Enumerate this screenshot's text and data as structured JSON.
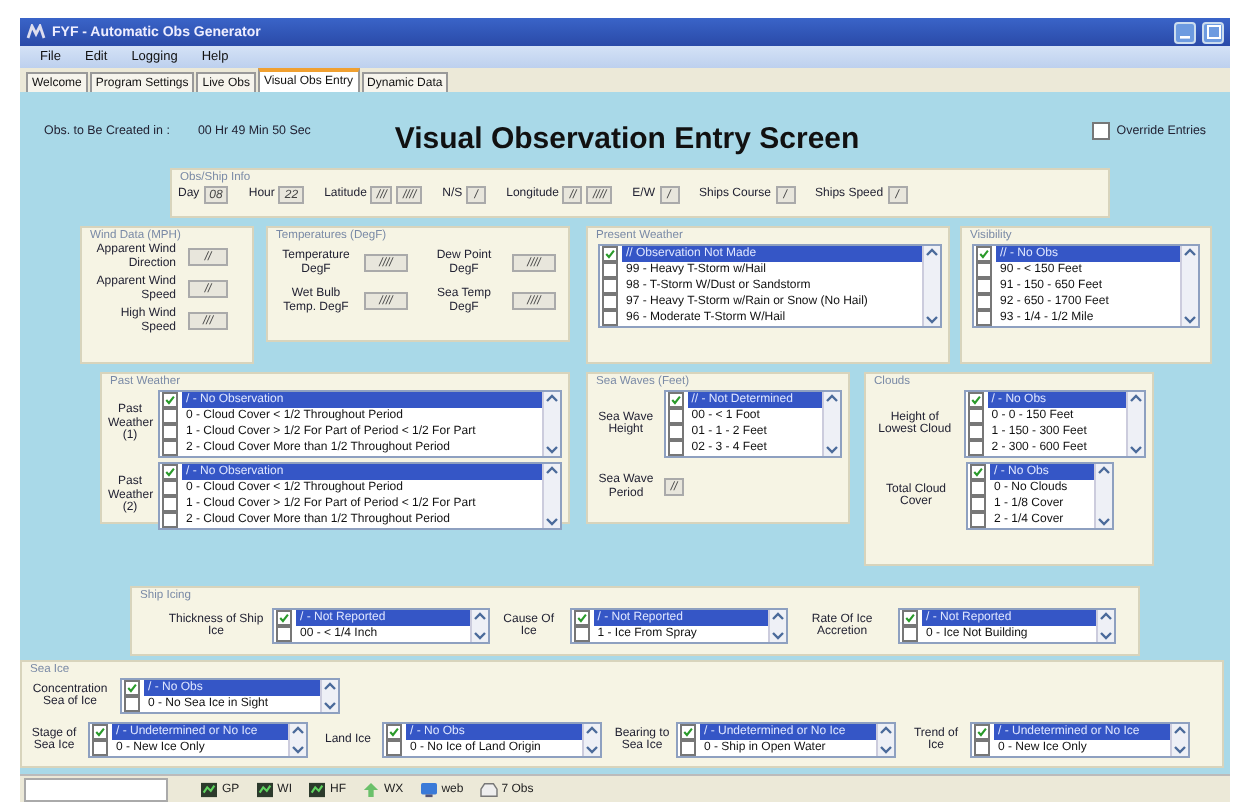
{
  "window": {
    "title": "FYF - Automatic Obs Generator"
  },
  "menu": [
    "File",
    "Edit",
    "Logging",
    "Help"
  ],
  "tabs": [
    {
      "label": "Welcome",
      "selected": false
    },
    {
      "label": "Program Settings",
      "selected": false
    },
    {
      "label": "Live Obs",
      "selected": false
    },
    {
      "label": "Visual Obs Entry",
      "selected": true
    },
    {
      "label": "Dynamic Data",
      "selected": false
    }
  ],
  "countdown": {
    "label": "Obs. to Be Created in :",
    "value": "00 Hr 49 Min 50 Sec"
  },
  "heading": "Visual Observation Entry Screen",
  "override": {
    "label": "Override Entries",
    "checked": false
  },
  "groups": [
    {
      "title": "Obs/Ship Info",
      "rows": [
        {
          "kind": "field",
          "label": "Day",
          "values": [
            "08"
          ]
        },
        {
          "kind": "field",
          "label": "Hour",
          "values": [
            "22"
          ]
        },
        {
          "kind": "field",
          "label": "Latitude",
          "values": [
            "///",
            "////"
          ]
        },
        {
          "kind": "field",
          "label": "N/S",
          "values": [
            "/"
          ]
        },
        {
          "kind": "field",
          "label": "Longitude",
          "values": [
            "//",
            "////"
          ]
        },
        {
          "kind": "field",
          "label": "E/W",
          "values": [
            "/"
          ]
        },
        {
          "kind": "field",
          "label": "Ships Course",
          "values": [
            "/"
          ]
        },
        {
          "kind": "field",
          "label": "Ships Speed",
          "values": [
            "/"
          ]
        }
      ]
    },
    {
      "title": "Wind Data (MPH)",
      "rows": [
        {
          "kind": "field",
          "label": "Apparent Wind Direction",
          "values": [
            "//"
          ]
        },
        {
          "kind": "field",
          "label": "Apparent Wind Speed",
          "values": [
            "//"
          ]
        },
        {
          "kind": "field",
          "label": "High Wind Speed",
          "values": [
            "///"
          ]
        }
      ]
    },
    {
      "title": "Temperatures (DegF)",
      "rows": [
        {
          "kind": "field",
          "label": "Temperature DegF",
          "values": [
            "////"
          ]
        },
        {
          "kind": "field",
          "label": "Dew Point DegF",
          "values": [
            "////"
          ]
        },
        {
          "kind": "field",
          "label": "Wet Bulb Temp. DegF",
          "values": [
            "////"
          ]
        },
        {
          "kind": "field",
          "label": "Sea Temp DegF",
          "values": [
            "////"
          ]
        }
      ]
    },
    {
      "title": "Present Weather",
      "rows": [
        {
          "kind": "list",
          "items": [
            {
              "text": "// Observation Not Made",
              "checked": true,
              "selected": true
            },
            {
              "text": "99 - Heavy T-Storm w/Hail",
              "checked": false,
              "selected": false
            },
            {
              "text": "98 - T-Storm W/Dust or Sandstorm",
              "checked": false,
              "selected": false
            },
            {
              "text": "97 - Heavy T-Storm w/Rain or Snow (No Hail)",
              "checked": false,
              "selected": false
            },
            {
              "text": "96 - Moderate T-Storm W/Hail",
              "checked": false,
              "selected": false
            }
          ]
        }
      ]
    },
    {
      "title": "Visibility",
      "rows": [
        {
          "kind": "list",
          "items": [
            {
              "text": "// - No Obs",
              "checked": true,
              "selected": true
            },
            {
              "text": "90 - < 150 Feet",
              "checked": false,
              "selected": false
            },
            {
              "text": "91 - 150 - 650 Feet",
              "checked": false,
              "selected": false
            },
            {
              "text": "92 - 650 - 1700 Feet",
              "checked": false,
              "selected": false
            },
            {
              "text": "93 - 1/4 - 1/2 Mile",
              "checked": false,
              "selected": false
            }
          ]
        }
      ]
    },
    {
      "title": "Past Weather",
      "rows": [
        {
          "kind": "list",
          "label": "Past Weather (1)",
          "items": [
            {
              "text": "/ - No Observation",
              "checked": true,
              "selected": true
            },
            {
              "text": "0 - Cloud Cover < 1/2 Throughout Period",
              "checked": false,
              "selected": false
            },
            {
              "text": "1 - Cloud Cover > 1/2 For Part of Period < 1/2 For Part",
              "checked": false,
              "selected": false
            },
            {
              "text": "2 - Cloud Cover More than 1/2 Throughout Period",
              "checked": false,
              "selected": false
            }
          ]
        },
        {
          "kind": "list",
          "label": "Past Weather (2)",
          "items": [
            {
              "text": "/ - No Observation",
              "checked": true,
              "selected": true
            },
            {
              "text": "0 - Cloud Cover < 1/2 Throughout Period",
              "checked": false,
              "selected": false
            },
            {
              "text": "1 - Cloud Cover > 1/2 For Part of Period < 1/2 For Part",
              "checked": false,
              "selected": false
            },
            {
              "text": "2 - Cloud Cover More than 1/2 Throughout Period",
              "checked": false,
              "selected": false
            }
          ]
        }
      ]
    },
    {
      "title": "Sea Waves (Feet)",
      "rows": [
        {
          "kind": "list",
          "label": "Sea Wave Height",
          "items": [
            {
              "text": "// - Not Determined",
              "checked": true,
              "selected": true
            },
            {
              "text": "00 - < 1 Foot",
              "checked": false,
              "selected": false
            },
            {
              "text": "01 - 1 - 2 Feet",
              "checked": false,
              "selected": false
            },
            {
              "text": "02 - 3 - 4 Feet",
              "checked": false,
              "selected": false
            }
          ]
        },
        {
          "kind": "field",
          "label": "Sea Wave Period",
          "values": [
            "//"
          ]
        }
      ]
    },
    {
      "title": "Clouds",
      "rows": [
        {
          "kind": "list",
          "label": "Height of Lowest Cloud",
          "items": [
            {
              "text": "/ - No Obs",
              "checked": true,
              "selected": true
            },
            {
              "text": "0 - 0 - 150 Feet",
              "checked": false,
              "selected": false
            },
            {
              "text": "1 - 150 - 300 Feet",
              "checked": false,
              "selected": false
            },
            {
              "text": "2 - 300 - 600 Feet",
              "checked": false,
              "selected": false
            }
          ]
        },
        {
          "kind": "list",
          "label": "Total Cloud Cover",
          "items": [
            {
              "text": "/ - No Obs",
              "checked": true,
              "selected": true
            },
            {
              "text": "0 - No Clouds",
              "checked": false,
              "selected": false
            },
            {
              "text": "1 - 1/8 Cover",
              "checked": false,
              "selected": false
            },
            {
              "text": "2 - 1/4 Cover",
              "checked": false,
              "selected": false
            }
          ]
        }
      ]
    },
    {
      "title": "Ship Icing",
      "rows": [
        {
          "kind": "list",
          "label": "Thickness of Ship Ice",
          "items": [
            {
              "text": "/ - Not Reported",
              "checked": true,
              "selected": true
            },
            {
              "text": "00 - < 1/4 Inch",
              "checked": false,
              "selected": false
            }
          ]
        },
        {
          "kind": "list",
          "label": "Cause Of Ice",
          "items": [
            {
              "text": "/ - Not Reported",
              "checked": true,
              "selected": true
            },
            {
              "text": "1 - Ice From Spray",
              "checked": false,
              "selected": false
            }
          ]
        },
        {
          "kind": "list",
          "label": "Rate Of Ice Accretion",
          "items": [
            {
              "text": "/ - Not Reported",
              "checked": true,
              "selected": true
            },
            {
              "text": "0 - Ice Not Building",
              "checked": false,
              "selected": false
            }
          ]
        }
      ]
    },
    {
      "title": "Sea Ice",
      "rows": [
        {
          "kind": "list",
          "label": "Concentration Sea of Ice",
          "items": [
            {
              "text": "/ - No Obs",
              "checked": true,
              "selected": true
            },
            {
              "text": "0 - No Sea Ice in Sight",
              "checked": false,
              "selected": false
            }
          ]
        },
        {
          "kind": "list",
          "label": "Stage of Sea Ice",
          "items": [
            {
              "text": "/ - Undetermined or No Ice",
              "checked": true,
              "selected": true
            },
            {
              "text": "0 - New Ice Only",
              "checked": false,
              "selected": false
            }
          ]
        },
        {
          "kind": "list",
          "label": "Land Ice",
          "items": [
            {
              "text": "/ - No Obs",
              "checked": true,
              "selected": true
            },
            {
              "text": "0 - No Ice of Land Origin",
              "checked": false,
              "selected": false
            }
          ]
        },
        {
          "kind": "list",
          "label": "Bearing to Sea Ice",
          "items": [
            {
              "text": "/ - Undetermined or No Ice",
              "checked": true,
              "selected": true
            },
            {
              "text": "0 - Ship in Open Water",
              "checked": false,
              "selected": false
            }
          ]
        },
        {
          "kind": "list",
          "label": "Trend of Ice",
          "items": [
            {
              "text": "/ - Undetermined or No Ice",
              "checked": true,
              "selected": true
            },
            {
              "text": "0 - New Ice Only",
              "checked": false,
              "selected": false
            }
          ]
        }
      ]
    }
  ],
  "status_bar": [
    {
      "kind": "chip",
      "text": "GP"
    },
    {
      "kind": "chip",
      "text": "WI"
    },
    {
      "kind": "chip",
      "text": "HF"
    },
    {
      "kind": "arrow",
      "text": "WX"
    },
    {
      "kind": "screen",
      "text": "web"
    },
    {
      "kind": "tray",
      "text": "7 Obs"
    }
  ]
}
